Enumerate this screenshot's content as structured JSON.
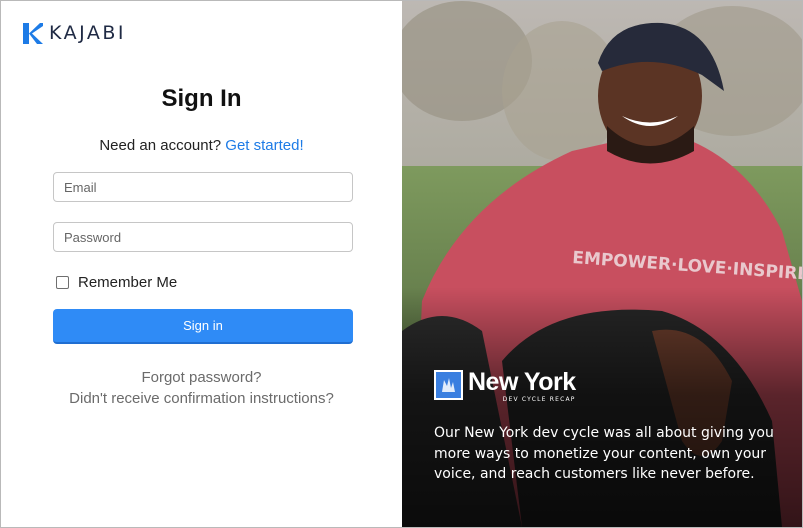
{
  "brand": {
    "wordmark": "KAJABI",
    "accent_color": "#1d7be6"
  },
  "form": {
    "title": "Sign In",
    "signup_prompt": "Need an account?",
    "signup_link": "Get started!",
    "email_placeholder": "Email",
    "password_placeholder": "Password",
    "remember_label": "Remember Me",
    "remember_checked": false,
    "submit_label": "Sign in",
    "forgot_link": "Forgot password?",
    "confirmation_link": "Didn't receive confirmation instructions?"
  },
  "promo": {
    "logo_title": "New York",
    "logo_subtitle": "DEV CYCLE RECAP",
    "caption": "Our New York dev cycle was all about giving you more ways to monetize your content, own your voice, and reach customers like never before.",
    "hoodie_text": "EMPOWER·LOVE·INSPIRE",
    "logo_color": "#3a7fe0"
  }
}
